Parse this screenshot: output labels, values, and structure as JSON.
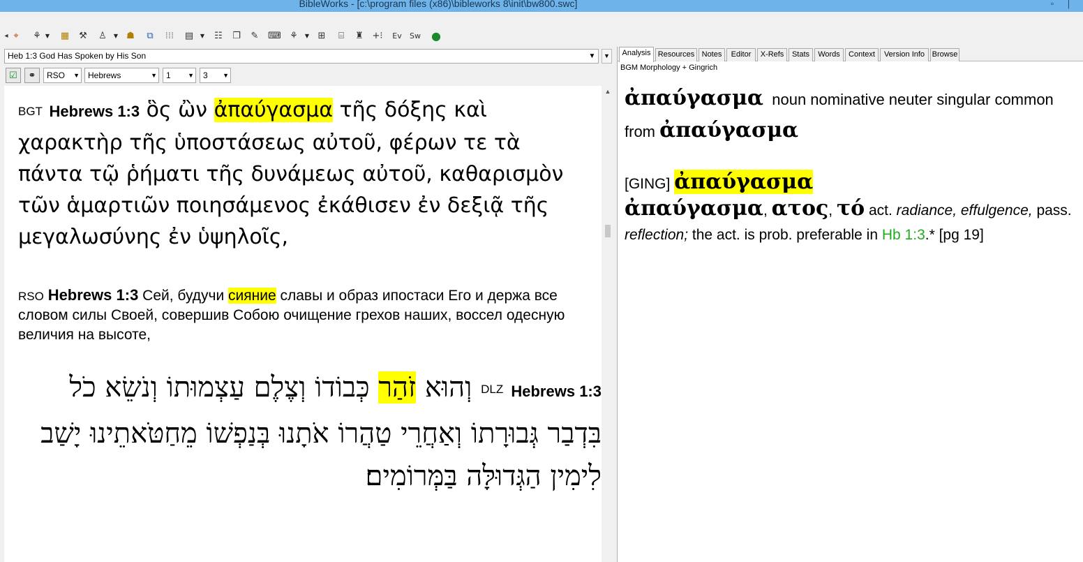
{
  "window": {
    "title": "BibleWorks - [c:\\program files (x86)\\bibleworks 8\\init\\bw800.swc]"
  },
  "toolbar": {
    "icons": [
      "crosshair-icon",
      "target-icon",
      "tree-icon",
      "calendar-icon",
      "tools-icon",
      "person-icon",
      "group-icon",
      "windows-icon",
      "dots-icon",
      "grid-icon",
      "list-icon",
      "copy-icon",
      "notes-icon",
      "keyboard-icon",
      "tree2-icon",
      "squares-icon",
      "lexicon-icon",
      "user-icon",
      "plus-icon",
      "ev-icon",
      "sw-icon",
      "globe-icon"
    ],
    "ev_label": "Ev",
    "sw_label": "Sw"
  },
  "left": {
    "verse_selector": "Heb 1:3 God Has Spoken by His Son",
    "version_combo": "RSO",
    "book_combo": "Hebrews",
    "chapter_combo": "1",
    "verse_combo": "3"
  },
  "verses": {
    "bgt": {
      "tag": "BGT",
      "ref": "Hebrews 1:3",
      "pre": "ὃς ὢν ",
      "highlight": "ἀπαύγασμα",
      "post": " τῆς δόξης καὶ χαρακτὴρ τῆς ὑποστάσεως αὐτοῦ, φέρων τε τὰ πάντα τῷ ῥήματι τῆς δυνάμεως αὐτοῦ, καθαρισμὸν τῶν ἁμαρτιῶν ποιησάμενος ἐκάθισεν ἐν δεξιᾷ τῆς μεγαλωσύνης ἐν ὑψηλοῖς,"
    },
    "rso": {
      "tag": "RSO",
      "ref": "Hebrews 1:3",
      "pre": "Сей, будучи ",
      "highlight": "сияние",
      "post": " славы и образ ипостаси Его и держа все словом силы Своей, совершив Собою очищение грехов наших, воссел одесную величия на высоте,"
    },
    "dlz": {
      "tag": "DLZ",
      "ref": "Hebrews 1:3",
      "pre": "וְהוּא ",
      "highlight": "זֹהַר",
      "post": " כְּבוֹדוֹ וְצֶלֶם עַצְמוּתוֹ וְנֹשֵׂא כֹל בִּדְבַר גְּבוּרָתוֹ וְאַחֲרֵי טַהֲרוֹ אֹתָנוּ בְּנַפְשׁוֹ מֵחַטֹּאתֵינוּ יָשַׁב לִימִין הַגְּדוּלָּה בַּמְּרוֹמִים׃"
    }
  },
  "right": {
    "tabs": [
      "Analysis",
      "Resources",
      "Notes",
      "Editor",
      "X-Refs",
      "Stats",
      "Words",
      "Context",
      "Version Info",
      "Browse"
    ],
    "active_tab": "Analysis",
    "source_label": "BGM Morphology + Gingrich",
    "morph": {
      "word": "ἀπαύγασμα",
      "parse": "noun nominative neuter singular common",
      "from_label": "from",
      "lemma": "ἀπαύγασμα"
    },
    "ging": {
      "tag": "[GING]",
      "headword": "ἀπαύγασμα",
      "entry_word": "ἀπαύγασμα",
      "comma1": ", ",
      "genitive": "ατος",
      "comma2": ", ",
      "article": "τό",
      "act_label": " act. ",
      "act_meaning": "radiance, effulgence,",
      "pass_label": " pass. ",
      "pass_meaning": "reflection;",
      "note_pre": " the act. is prob. preferable in ",
      "ref_link": "Hb 1:3",
      "note_post": ".* [pg 19]"
    }
  },
  "colors": {
    "highlight": "#ffff00",
    "link": "#22aa22",
    "titlebar": "#6eb4ea"
  }
}
